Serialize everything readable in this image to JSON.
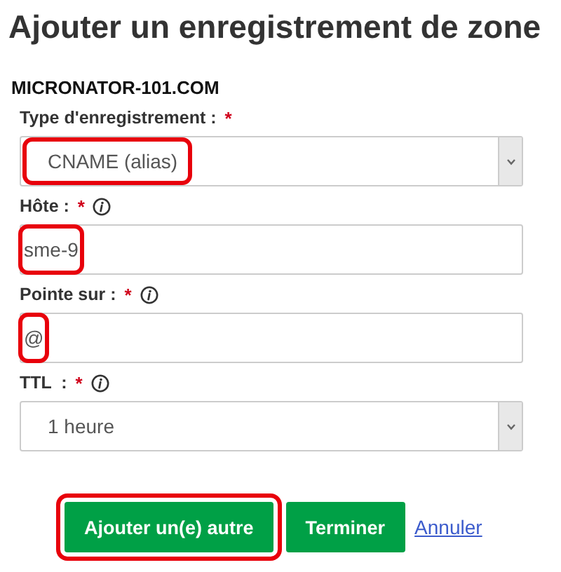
{
  "title": "Ajouter un enregistrement de zone",
  "domain": "MICRONATOR-101.COM",
  "fields": [
    {
      "kind": "select",
      "label": "Type d'enregistrement :",
      "required_mark": "*",
      "info": false,
      "value": "CNAME (alias)",
      "highlighted": true
    },
    {
      "kind": "text",
      "label": "Hôte :",
      "required_mark": "*",
      "info": true,
      "value": "sme-9",
      "highlighted": true
    },
    {
      "kind": "text",
      "label": "Pointe sur :",
      "required_mark": "*",
      "info": true,
      "value": "@",
      "highlighted": true
    },
    {
      "kind": "select",
      "label": "TTL  :",
      "required_mark": "*",
      "info": true,
      "value": "1 heure",
      "highlighted": false
    }
  ],
  "buttons": [
    {
      "kind": "primary",
      "label": "Ajouter un(e) autre",
      "highlighted": true
    },
    {
      "kind": "primary",
      "label": "Terminer",
      "highlighted": false
    },
    {
      "kind": "link",
      "label": "Annuler",
      "highlighted": false
    }
  ]
}
